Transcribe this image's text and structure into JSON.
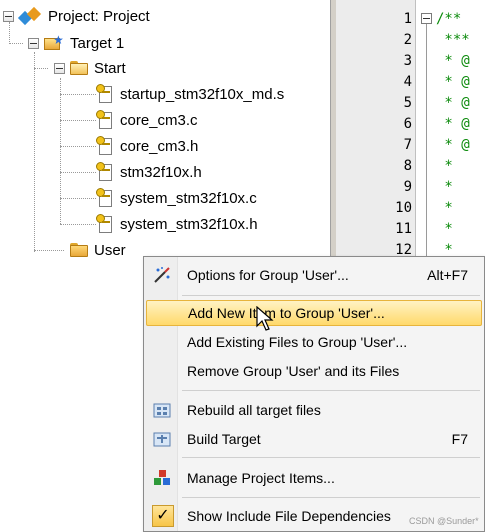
{
  "project_tree": {
    "project_label": "Project: Project",
    "target_label": "Target 1",
    "start_group_label": "Start",
    "start_files": [
      "startup_stm32f10x_md.s",
      "core_cm3.c",
      "core_cm3.h",
      "stm32f10x.h",
      "system_stm32f10x.c",
      "system_stm32f10x.h"
    ],
    "user_group_label": "User"
  },
  "editor": {
    "line_numbers": [
      "1",
      "2",
      "3",
      "4",
      "5",
      "6",
      "7",
      "8",
      "9",
      "10",
      "11",
      "12"
    ],
    "code_lines": [
      "/**",
      " ***",
      " * @",
      " * @",
      " * @",
      " * @",
      " * @",
      " *",
      " *",
      " *",
      " *",
      " *"
    ]
  },
  "context_menu": {
    "options_label": "Options for Group 'User'...",
    "options_shortcut": "Alt+F7",
    "add_new_label": "Add New  Item to Group 'User'...",
    "add_existing_label": "Add Existing Files to Group 'User'...",
    "remove_label": "Remove Group 'User' and its Files",
    "rebuild_label": "Rebuild all target files",
    "build_label": "Build Target",
    "build_shortcut": "F7",
    "manage_label": "Manage Project Items...",
    "show_include_label": "Show Include File Dependencies",
    "show_include_checked": true,
    "highlighted_item": "Add New  Item to Group 'User'..."
  },
  "colors": {
    "highlight": "#ffd96b",
    "code_comment": "#0a8a0a",
    "folder": "#e8a83a"
  },
  "watermark": "CSDN @Sunder*"
}
